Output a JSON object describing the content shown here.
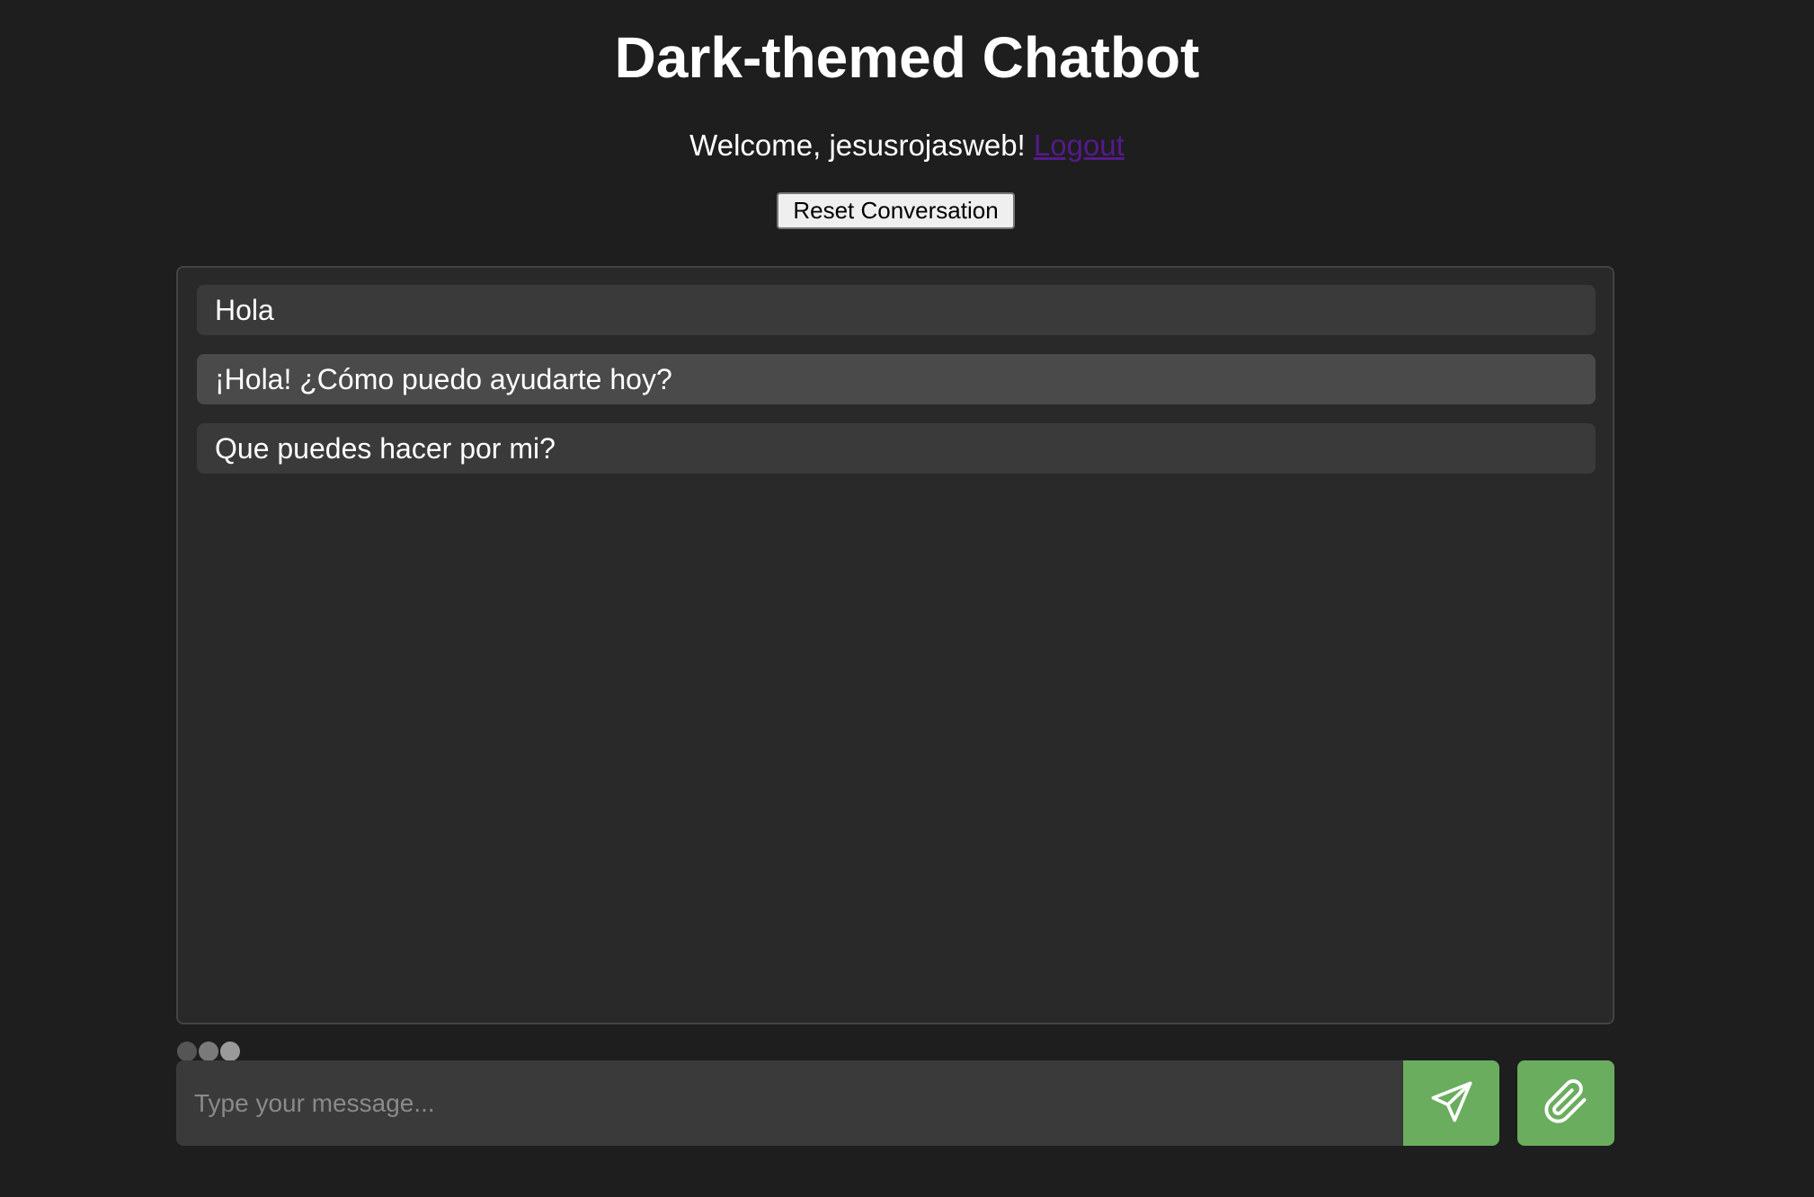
{
  "header": {
    "title": "Dark-themed Chatbot",
    "welcome_text": "Welcome, jesusrojasweb!",
    "logout_label": "Logout",
    "reset_label": "Reset Conversation"
  },
  "chat": {
    "messages": [
      {
        "role": "user",
        "text": "Hola"
      },
      {
        "role": "bot",
        "text": "¡Hola! ¿Cómo puedo ayudarte hoy?"
      },
      {
        "role": "user",
        "text": "Que puedes hacer por mi?"
      }
    ]
  },
  "composer": {
    "placeholder": "Type your message...",
    "value": "",
    "send_icon": "send-paper-plane-icon",
    "attach_icon": "paperclip-icon"
  },
  "theme": {
    "background": "#1e1e1e",
    "panel": "#292929",
    "user_bubble": "#3a3a3a",
    "bot_bubble": "#4a4a4a",
    "accent": "#6aad5e",
    "link": "#551a8b",
    "typing_dots": [
      "#555555",
      "#7a7a7a",
      "#9a9a9a"
    ]
  }
}
